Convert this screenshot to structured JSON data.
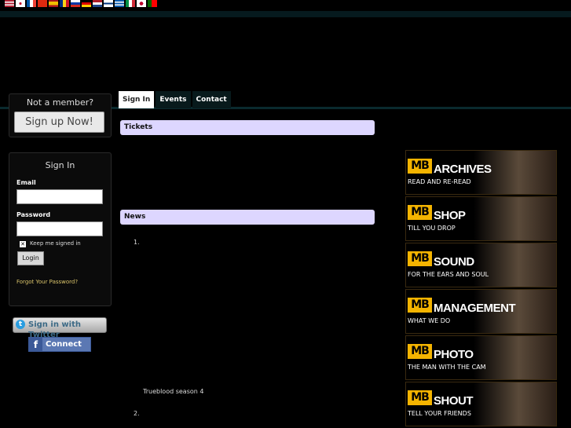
{
  "flags": [
    {
      "name": "us-flag",
      "color": "#3c5aa6"
    },
    {
      "name": "kr-flag",
      "color": "#ffffff"
    },
    {
      "name": "fr-flag",
      "color": "#4a6fc8"
    },
    {
      "name": "cn-flag",
      "color": "#de2910"
    },
    {
      "name": "es-flag",
      "color": "#f1bf00"
    },
    {
      "name": "ro-flag",
      "color": "#fcd116"
    },
    {
      "name": "ru-flag",
      "color": "#d52b1e"
    },
    {
      "name": "de-flag",
      "color": "#dd0000"
    },
    {
      "name": "nl-flag",
      "color": "#ae1c28"
    },
    {
      "name": "fi-flag",
      "color": "#ffffff"
    },
    {
      "name": "gr-flag",
      "color": "#0d5eaf"
    },
    {
      "name": "it-flag",
      "color": "#009246"
    },
    {
      "name": "jp-flag",
      "color": "#ffffff"
    },
    {
      "name": "pt-flag",
      "color": "#006600"
    }
  ],
  "sidebar": {
    "not_member": "Not a member?",
    "signup_button": "Sign up Now!",
    "signin_title": "Sign In",
    "email_label": "Email",
    "password_label": "Password",
    "keep_signed": "Keep me signed in",
    "login_button": "Login",
    "forgot": "Forgot Your Password?",
    "twitter_button": "Sign in with Twitter",
    "facebook_button": "Connect"
  },
  "tabs": [
    {
      "label": "Sign In",
      "active": true
    },
    {
      "label": "Events",
      "active": false
    },
    {
      "label": "Contact",
      "active": false
    }
  ],
  "main": {
    "tickets_header": "Tickets",
    "news_header": "News",
    "item1_num": "1.",
    "item1_text": "Trueblood season 4",
    "item2_num": "2."
  },
  "banners": [
    {
      "mb": "MB",
      "word": "ARCHIVES",
      "sub": "READ AND RE-READ"
    },
    {
      "mb": "MB",
      "word": "SHOP",
      "sub": "TILL YOU DROP"
    },
    {
      "mb": "MB",
      "word": "SOUND",
      "sub": "FOR THE EARS AND SOUL"
    },
    {
      "mb": "MB",
      "word": "MANAGEMENT",
      "sub": "WHAT WE DO"
    },
    {
      "mb": "MB",
      "word": "PHOTO",
      "sub": "THE MAN WITH THE CAM"
    },
    {
      "mb": "MB",
      "word": "SHOUT",
      "sub": "TELL YOUR FRIENDS"
    }
  ],
  "colors": {
    "accent": "#f4b400",
    "panel_header": "#ddd6ff",
    "link": "#d9c36a"
  }
}
